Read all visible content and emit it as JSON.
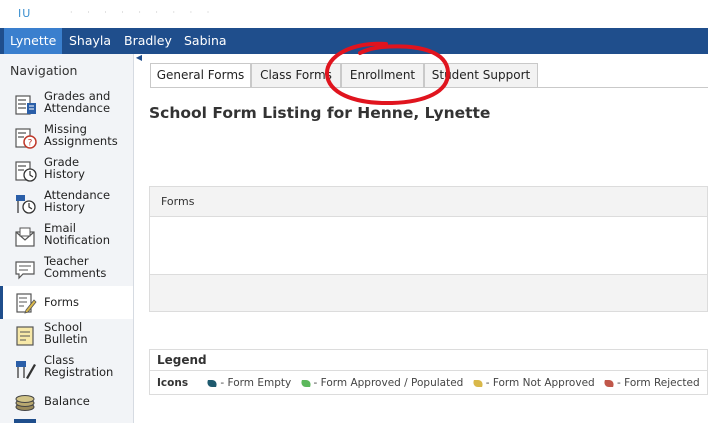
{
  "header": {
    "logo": "IU",
    "students": [
      {
        "name": "Lynette",
        "active": true
      },
      {
        "name": "Shayla",
        "active": false
      },
      {
        "name": "Bradley",
        "active": false
      },
      {
        "name": "Sabina",
        "active": false
      }
    ]
  },
  "sidebar": {
    "heading": "Navigation",
    "items": [
      {
        "line1": "Grades and",
        "line2": "Attendance",
        "icon": "grades-attendance-icon"
      },
      {
        "line1": "Missing",
        "line2": "Assignments",
        "icon": "missing-assignments-icon"
      },
      {
        "line1": "Grade",
        "line2": "History",
        "icon": "grade-history-icon"
      },
      {
        "line1": "Attendance",
        "line2": "History",
        "icon": "attendance-history-icon"
      },
      {
        "line1": "Email",
        "line2": "Notification",
        "icon": "email-icon"
      },
      {
        "line1": "Teacher",
        "line2": "Comments",
        "icon": "comments-icon"
      },
      {
        "line1": "Forms",
        "line2": "",
        "icon": "forms-icon",
        "active": true
      },
      {
        "line1": "School",
        "line2": "Bulletin",
        "icon": "bulletin-icon"
      },
      {
        "line1": "Class",
        "line2": "Registration",
        "icon": "class-registration-icon"
      },
      {
        "line1": "Balance",
        "line2": "",
        "icon": "balance-icon"
      }
    ]
  },
  "tabs": [
    {
      "label": "General Forms",
      "active": true
    },
    {
      "label": "Class Forms",
      "active": false
    },
    {
      "label": "Enrollment",
      "active": false
    },
    {
      "label": "Student Support",
      "active": false
    }
  ],
  "main": {
    "title": "School Form Listing for Henne, Lynette",
    "forms_header": "Forms"
  },
  "legend": {
    "title": "Legend",
    "icons_label": "Icons",
    "entries": [
      {
        "label": "- Form Empty",
        "color": "#1e5a6e"
      },
      {
        "label": "- Form Approved / Populated",
        "color": "#5cb85c"
      },
      {
        "label": "- Form Not Approved",
        "color": "#d9b84a"
      },
      {
        "label": "- Form Rejected",
        "color": "#c0574a"
      }
    ]
  },
  "annotation_color": "#e0141e"
}
